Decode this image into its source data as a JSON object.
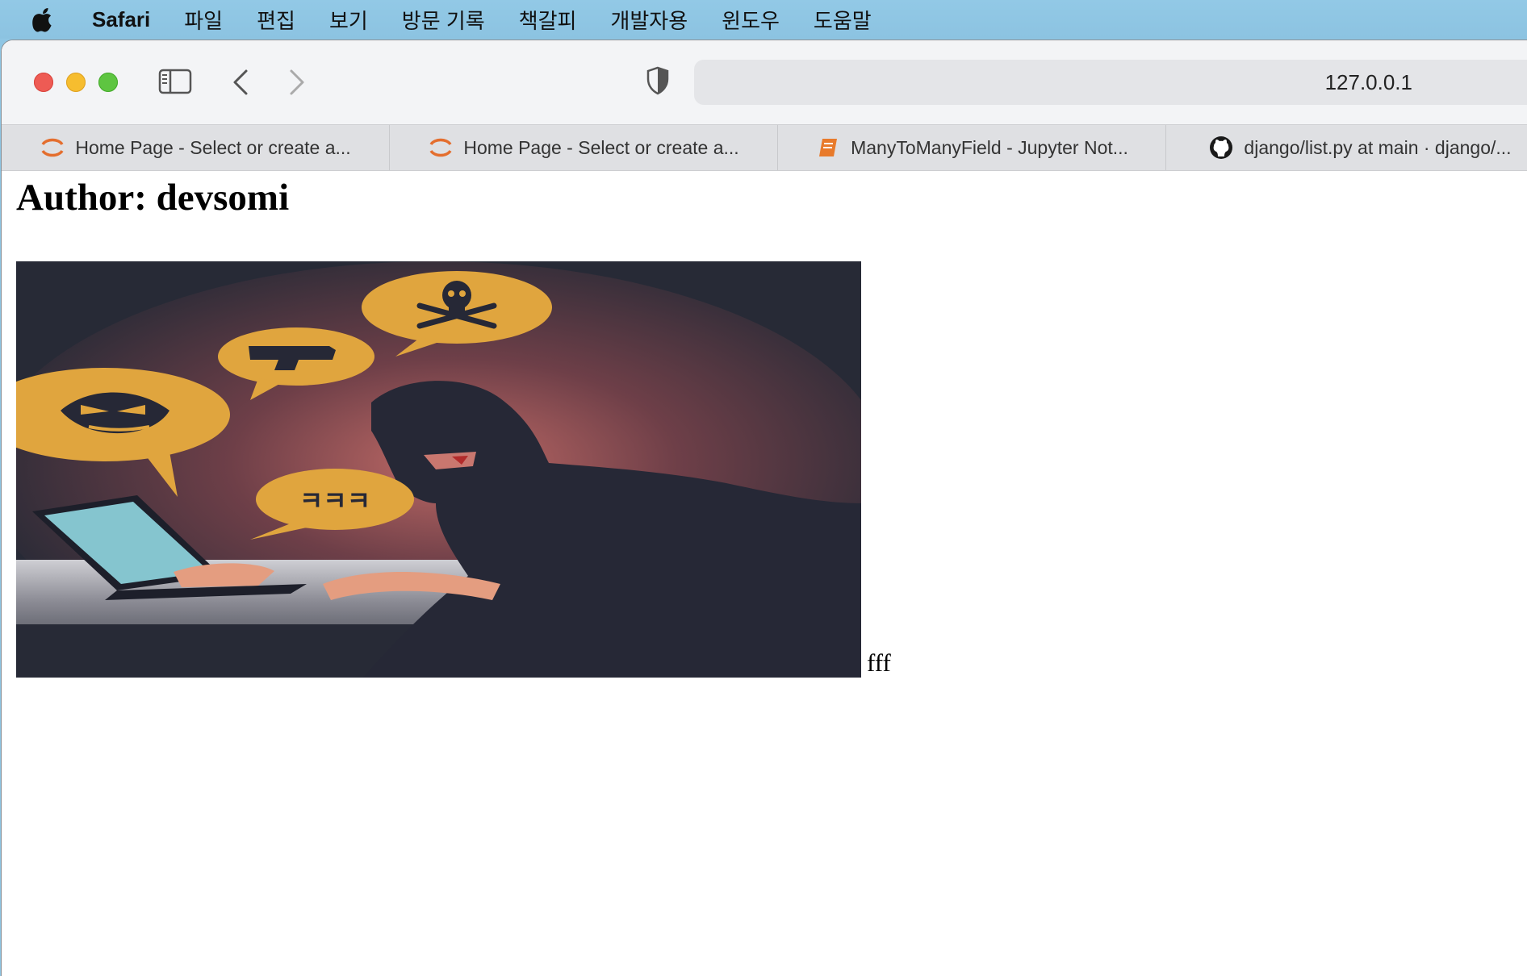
{
  "menubar": {
    "app": "Safari",
    "items": [
      "파일",
      "편집",
      "보기",
      "방문 기록",
      "책갈피",
      "개발자용",
      "윈도우",
      "도움말"
    ]
  },
  "browser": {
    "url": "127.0.0.1",
    "tabs": [
      {
        "title": "Home Page - Select or create a...",
        "icon": "jupyter-icon"
      },
      {
        "title": "Home Page - Select or create a...",
        "icon": "jupyter-icon"
      },
      {
        "title": "ManyToManyField - Jupyter Not...",
        "icon": "notebook-icon"
      },
      {
        "title": "django/list.py at main · django/...",
        "icon": "github-icon"
      }
    ]
  },
  "page": {
    "heading": "Author: devsomi",
    "image_bubble_text": "ㅋㅋㅋ",
    "caption": "fff"
  },
  "colors": {
    "menubar": "#8fc6e4",
    "image_bg": "#272a36",
    "bubble": "#e0a53e",
    "laptop_screen": "#85c5cf"
  }
}
